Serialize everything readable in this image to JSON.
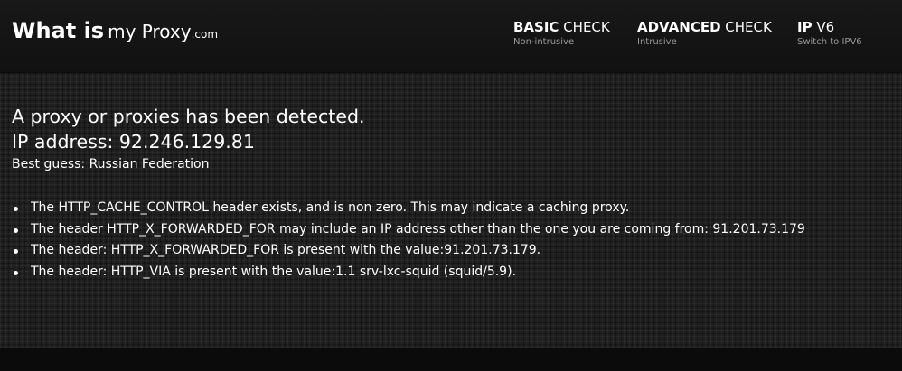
{
  "header": {
    "logo": {
      "bold": "What is",
      "name": "my Proxy",
      "domain": ".com"
    },
    "nav": [
      {
        "title_bold": "BASIC",
        "title_rest": " CHECK",
        "subtitle": "Non-intrusive"
      },
      {
        "title_bold": "ADVANCED",
        "title_rest": " CHECK",
        "subtitle": "Intrusive"
      },
      {
        "title_bold": "IP",
        "title_rest": " V6",
        "subtitle": "Switch to IPV6"
      }
    ]
  },
  "main": {
    "detection_line": "A proxy or proxies has been detected.",
    "ip_line": "IP address: 92.246.129.81",
    "best_guess": "Best guess: Russian Federation",
    "findings": [
      "The HTTP_CACHE_CONTROL header exists, and is non zero. This may indicate a caching proxy.",
      "The header HTTP_X_FORWARDED_FOR may include an IP address other than the one you are coming from: 91.201.73.179",
      "The header: HTTP_X_FORWARDED_FOR is present with the value:91.201.73.179.",
      "The header: HTTP_VIA is present with the value:1.1 srv-lxc-squid (squid/5.9)."
    ]
  }
}
